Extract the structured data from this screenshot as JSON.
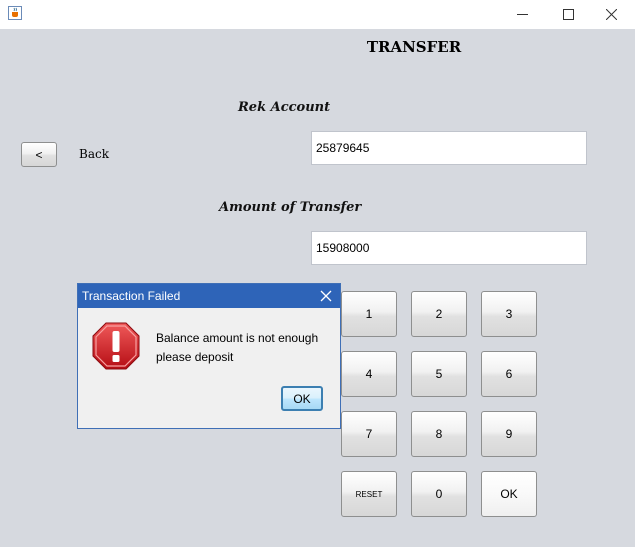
{
  "window": {
    "icon": "java-cup-icon",
    "controls": [
      "minimize-icon",
      "maximize-icon",
      "close-icon"
    ]
  },
  "header": {
    "title": "TRANSFER"
  },
  "form": {
    "account_label": "Rek Account",
    "account_value": "25879645",
    "amount_label": "Amount of Transfer",
    "amount_value": "15908000"
  },
  "back": {
    "button_label": "<",
    "label": "Back"
  },
  "keypad": {
    "keys": [
      "1",
      "2",
      "3",
      "4",
      "5",
      "6",
      "7",
      "8",
      "9",
      "RESET",
      "0",
      "OK"
    ]
  },
  "dialog": {
    "title": "Transaction Failed",
    "icon": "error-icon",
    "message_line1": "Balance amount is not enough",
    "message_line2": "please deposit",
    "ok_label": "OK",
    "colors": {
      "title_bar": "#2e64b8",
      "error_red": "#d2161e"
    }
  }
}
